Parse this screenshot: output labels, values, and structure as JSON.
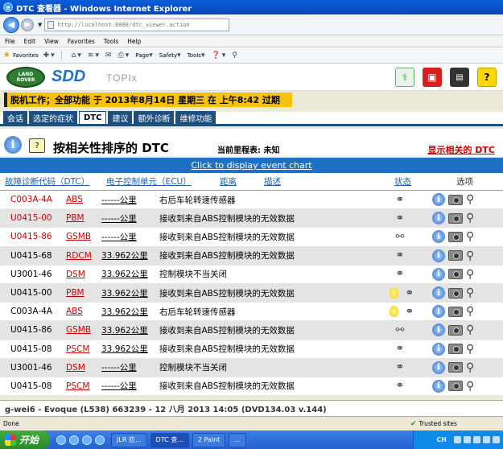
{
  "window": {
    "title": "DTC 查看器 - Windows Internet Explorer"
  },
  "address": {
    "url": "http://localhost:8080/dtc_viewer.action"
  },
  "menu": [
    "File",
    "Edit",
    "View",
    "Favorites",
    "Tools",
    "Help"
  ],
  "favbar": {
    "favorites": "Favorites",
    "page": "Page",
    "safety": "Safety",
    "tools": "Tools"
  },
  "header": {
    "logo_line1": "LAND",
    "logo_line2": "ROVER",
    "sdd": "SDD",
    "topix": "TOPIx",
    "help": "?"
  },
  "session": {
    "text": "脱机工作；全部功能 于 2013年8月14日 星期三 在 上午8:42 过期"
  },
  "tabs": [
    "会话",
    "选定的症状",
    "DTC",
    "建议",
    "额外诊断",
    "维修功能"
  ],
  "active_tab": "DTC",
  "page": {
    "title": "按相关性排序的 DTC",
    "mileage": "当前里程表: 未知",
    "show_related": "显示相关的 DTC",
    "event_chart": "Click to display event chart"
  },
  "table": {
    "headers": {
      "code": "故障诊断代码（DTC）",
      "ecu": "电子控制单元（ECU）",
      "distance": "距离",
      "description": "描述",
      "status": "状态",
      "options": "选项"
    },
    "rows": [
      {
        "code": "C003A-4A",
        "ecu": "ABS",
        "distance": "------公里",
        "description": "右后车轮转速传感器",
        "red": true,
        "bulb": false,
        "broken": false
      },
      {
        "code": "U0415-00",
        "ecu": "PBM",
        "distance": "------公里",
        "description": "接收到来自ABS控制模块的无效数据",
        "red": true,
        "bulb": false,
        "broken": false
      },
      {
        "code": "U0415-86",
        "ecu": "GSMB",
        "distance": "------公里",
        "description": "接收到来自ABS控制模块的无效数据",
        "red": true,
        "bulb": false,
        "broken": true
      },
      {
        "code": "U0415-68",
        "ecu": "RDCM",
        "distance": "33.962公里",
        "description": "接收到来自ABS控制模块的无效数据",
        "red": false,
        "bulb": false,
        "broken": false
      },
      {
        "code": "U3001-46",
        "ecu": "DSM",
        "distance": "33.962公里",
        "description": "控制模块不当关闭",
        "red": false,
        "bulb": false,
        "broken": false
      },
      {
        "code": "U0415-00",
        "ecu": "PBM",
        "distance": "33.962公里",
        "description": "接收到来自ABS控制模块的无效数据",
        "red": false,
        "bulb": true,
        "broken": false
      },
      {
        "code": "C003A-4A",
        "ecu": "ABS",
        "distance": "33.962公里",
        "description": "右后车轮转速传感器",
        "red": false,
        "bulb": true,
        "broken": false
      },
      {
        "code": "U0415-86",
        "ecu": "GSMB",
        "distance": "33.962公里",
        "description": "接收到来自ABS控制模块的无效数据",
        "red": false,
        "bulb": false,
        "broken": true
      },
      {
        "code": "U0415-08",
        "ecu": "PSCM",
        "distance": "33.962公里",
        "description": "接收到来自ABS控制模块的无效数据",
        "red": false,
        "bulb": false,
        "broken": false
      },
      {
        "code": "U3001-46",
        "ecu": "DSM",
        "distance": "------公里",
        "description": "控制模块不当关闭",
        "red": false,
        "bulb": false,
        "broken": false
      },
      {
        "code": "U0415-08",
        "ecu": "PSCM",
        "distance": "------公里",
        "description": "接收到来自ABS控制模块的无效数据",
        "red": false,
        "bulb": false,
        "broken": false
      }
    ]
  },
  "footer": {
    "vehicle": "g-wei6 - Evoque (L538) 663239 - 12 八月 2013 14:05 (DVD134.03 v.144)"
  },
  "statusbar": {
    "left": "Done",
    "zone": "Trusted sites"
  },
  "taskbar": {
    "start": "开始",
    "tasks": [
      "JLR 应...",
      "DTC 查...",
      "2 Paint",
      "..."
    ],
    "lang": "CH"
  },
  "colors": {
    "tab_blue": "#1f4f7d",
    "session_yellow": "#f6c20a",
    "event_blue": "#1f6fc4",
    "error_red": "#cc0000"
  }
}
